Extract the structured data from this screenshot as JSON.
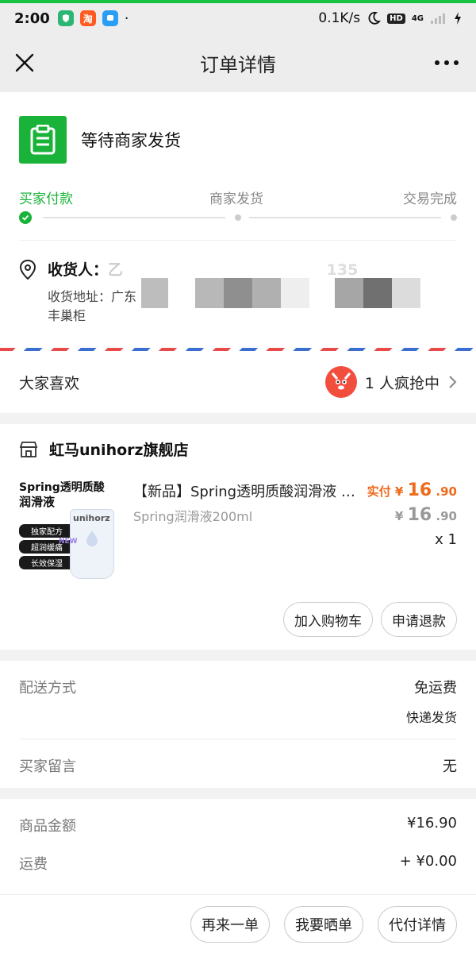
{
  "status_bar": {
    "time": "2:00",
    "app_icon_tao": "淘",
    "network_speed": "0.1K/s",
    "hd_badge": "HD",
    "signal_label": "4G"
  },
  "nav": {
    "title": "订单详情",
    "close_icon": "close-icon",
    "more_icon": "more-icon"
  },
  "order_status": {
    "text": "等待商家发货",
    "icon": "clipboard-icon",
    "icon_color": "#19b339"
  },
  "steps": [
    {
      "label": "买家付款",
      "active": true
    },
    {
      "label": "商家发货",
      "active": false
    },
    {
      "label": "交易完成",
      "active": false
    }
  ],
  "address": {
    "receiver_label": "收货人：",
    "receiver_name_visible": "乙",
    "phone_visible": "135",
    "address_label": "收货地址：",
    "address_visible": "广东",
    "address_line2": "丰巢柜"
  },
  "recommend": {
    "title": "大家喜欢",
    "rush_text": "1 人疯抢中"
  },
  "shop": {
    "name": "虹马unihorz旗舰店",
    "icon": "store-icon"
  },
  "goods": {
    "image_brand_line1": "Spring透明质酸",
    "image_brand_line2": "润滑液",
    "image_tags": [
      "独家配方",
      "超润缓痛",
      "长效保湿"
    ],
    "image_product_logo": "unihorz",
    "image_new_badge": "NEW",
    "title": "【新品】Spring透明质酸润滑液 unihorz",
    "spec": "Spring润滑液200ml",
    "paid_label": "实付",
    "currency": "¥",
    "paid_int": "16",
    "paid_dec": ".90",
    "orig_int": "16",
    "orig_dec": ".90",
    "qty": "x 1",
    "accent_color": "#ee6a1c"
  },
  "goods_actions": {
    "add_cart": "加入购物车",
    "refund": "申请退款"
  },
  "delivery": {
    "method_label": "配送方式",
    "method_value": "免运费",
    "method_sub": "快递发货",
    "note_label": "买家留言",
    "note_value": "无"
  },
  "amounts": {
    "goods_label": "商品金额",
    "goods_value": "¥16.90",
    "shipping_label": "运费",
    "shipping_value": "+ ¥0.00"
  },
  "bottom_actions": {
    "reorder": "再来一单",
    "share": "我要晒单",
    "pay_detail": "代付详情"
  }
}
